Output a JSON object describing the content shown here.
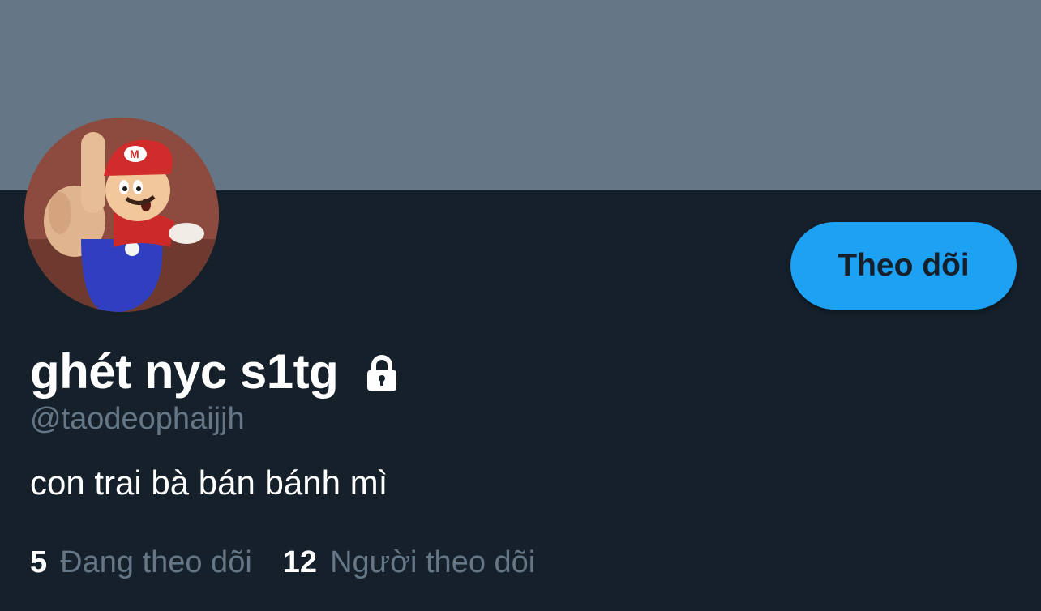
{
  "profile": {
    "display_name": "ghét nyc s1tg",
    "handle": "@taodeophaijjh",
    "bio": "con trai bà bán bánh mì",
    "protected_icon": "lock-icon",
    "avatar_icon": "mario-avatar"
  },
  "actions": {
    "follow_label": "Theo dõi"
  },
  "stats": {
    "following_count": "5",
    "following_label": "Đang theo dõi",
    "followers_count": "12",
    "followers_label": "Người theo dõi"
  },
  "colors": {
    "banner": "#657786",
    "background": "#15202b",
    "accent": "#1da1f2",
    "muted_text": "#657786",
    "primary_text": "#ffffff"
  }
}
